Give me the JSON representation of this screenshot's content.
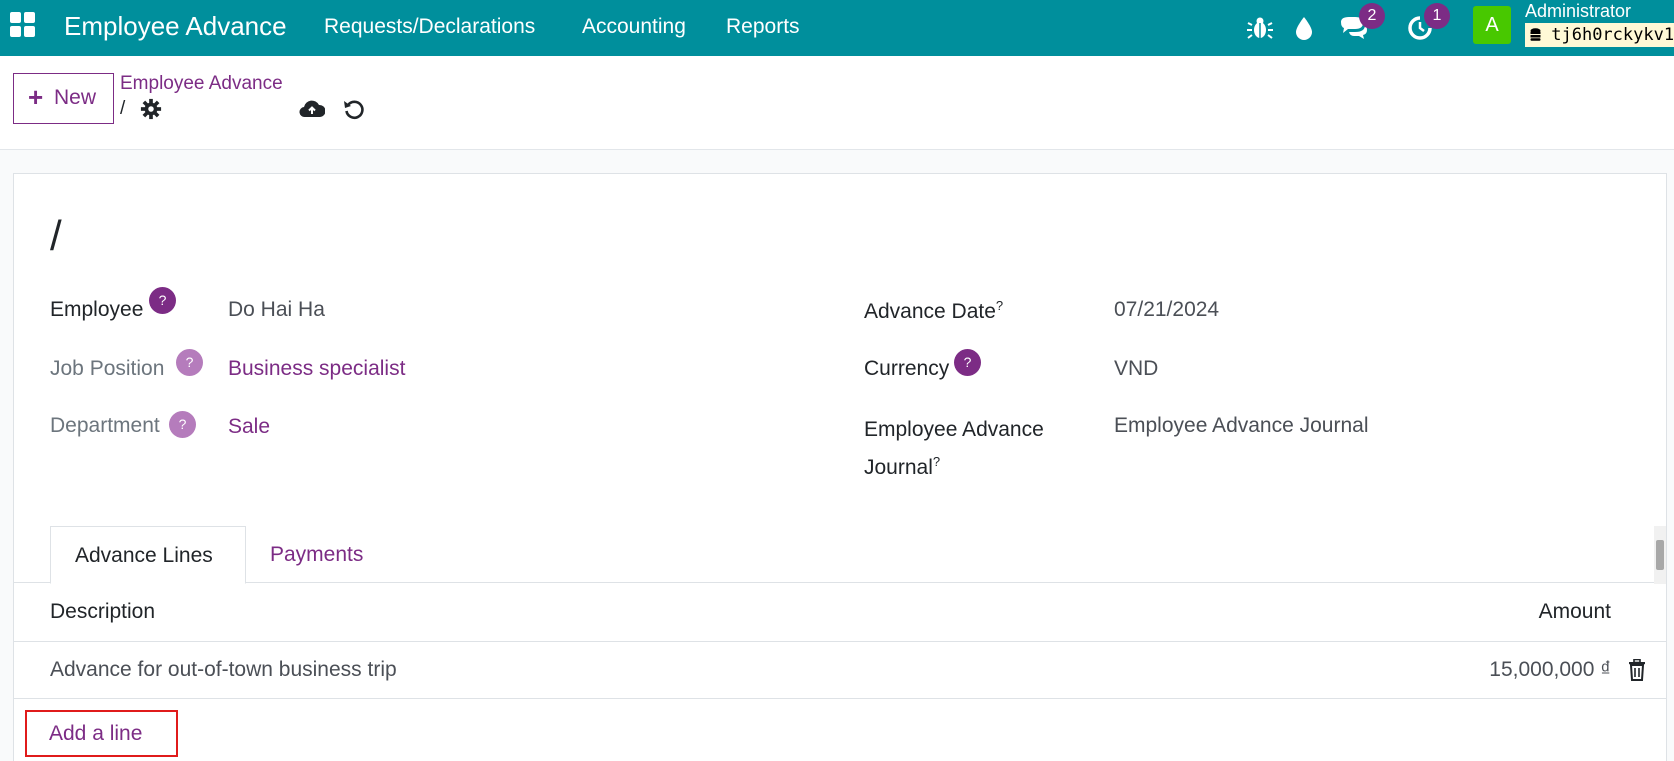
{
  "navbar": {
    "app_title": "Employee Advance",
    "menu": [
      "Requests/Declarations",
      "Accounting",
      "Reports"
    ],
    "messages_count": "2",
    "activities_count": "1",
    "avatar_letter": "A",
    "user_name": "Administrator",
    "db_name": "tj6h0rckykv1"
  },
  "control": {
    "new_label": "New",
    "breadcrumb_parent": "Employee Advance",
    "breadcrumb_current": "/"
  },
  "form": {
    "record_name": "/",
    "employee_label": "Employee",
    "employee_value": "Do Hai Ha",
    "job_position_label": "Job Position",
    "job_position_value": "Business specialist",
    "department_label": "Department",
    "department_value": "Sale",
    "advance_date_label": "Advance Date",
    "advance_date_value": "07/21/2024",
    "currency_label": "Currency",
    "currency_value": "VND",
    "journal_label_1": "Employee Advance",
    "journal_label_2": "Journal",
    "journal_value": "Employee Advance Journal",
    "help_mark": "?"
  },
  "tabs": [
    "Advance Lines",
    "Payments"
  ],
  "table": {
    "columns": [
      "Description",
      "Amount"
    ],
    "rows": [
      {
        "description": "Advance for out-of-town business trip",
        "amount": "15,000,000 ₫"
      }
    ],
    "add_line_label": "Add a line"
  },
  "colors": {
    "navbar": "#008f9c",
    "accent": "#7c2c85",
    "highlight_border": "#e01b1b"
  }
}
